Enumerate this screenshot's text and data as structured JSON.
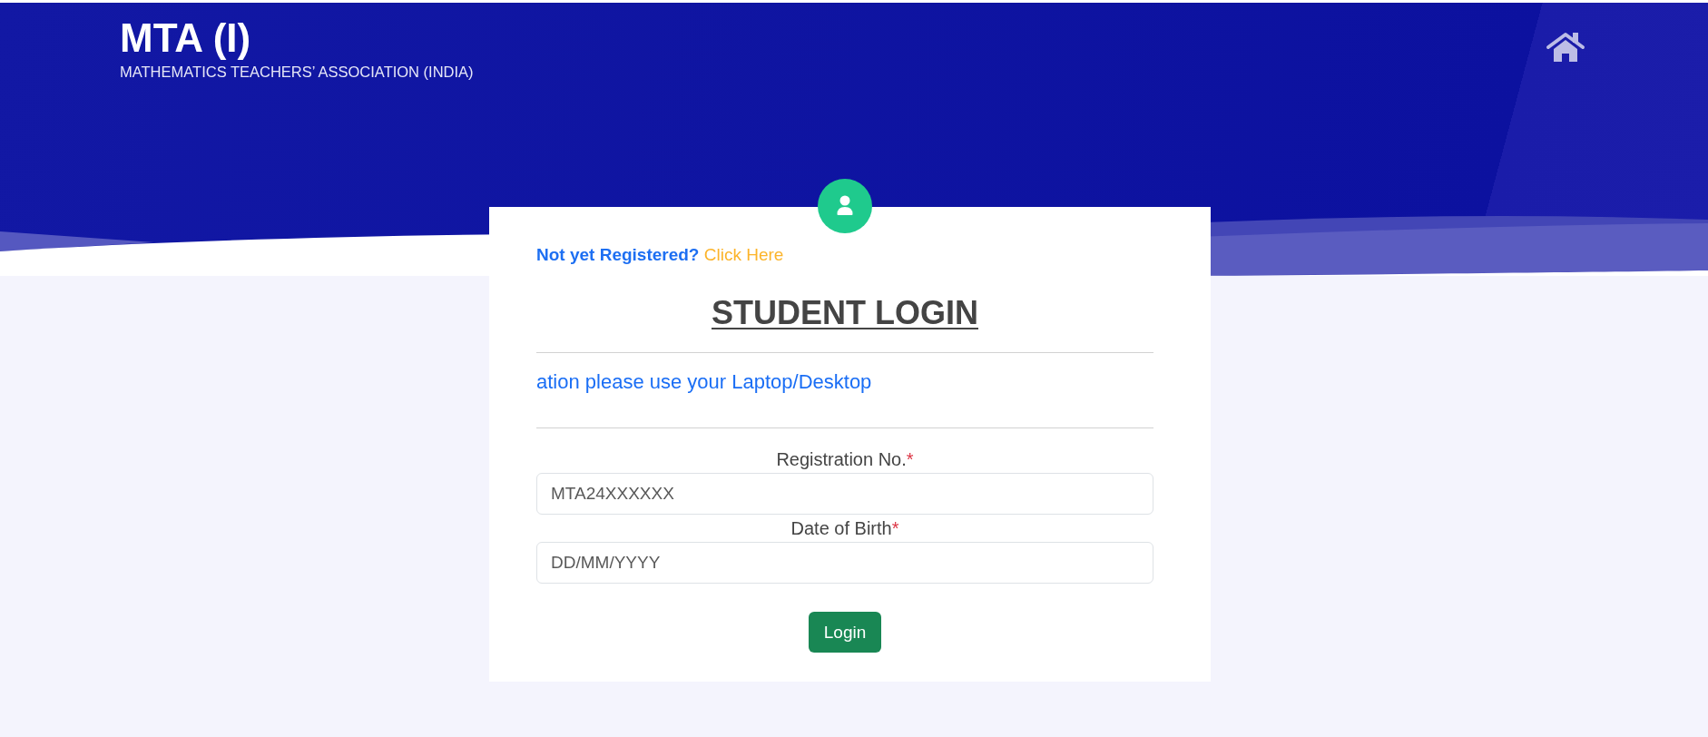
{
  "header": {
    "title": "MTA (I)",
    "subtitle": "MATHEMATICS TEACHERS’ ASSOCIATION (INDIA)"
  },
  "register_prompt": {
    "text": "Not yet Registered?",
    "link": "Click Here"
  },
  "heading": "STUDENT LOGIN",
  "notice": "ation please use your Laptop/Desktop",
  "fields": [
    {
      "label": "Registration No.",
      "required_mark": "*",
      "placeholder": "MTA24XXXXXX"
    },
    {
      "label": "Date of Birth",
      "required_mark": "*",
      "placeholder": "DD/MM/YYYY"
    }
  ],
  "submit_button": "Login"
}
